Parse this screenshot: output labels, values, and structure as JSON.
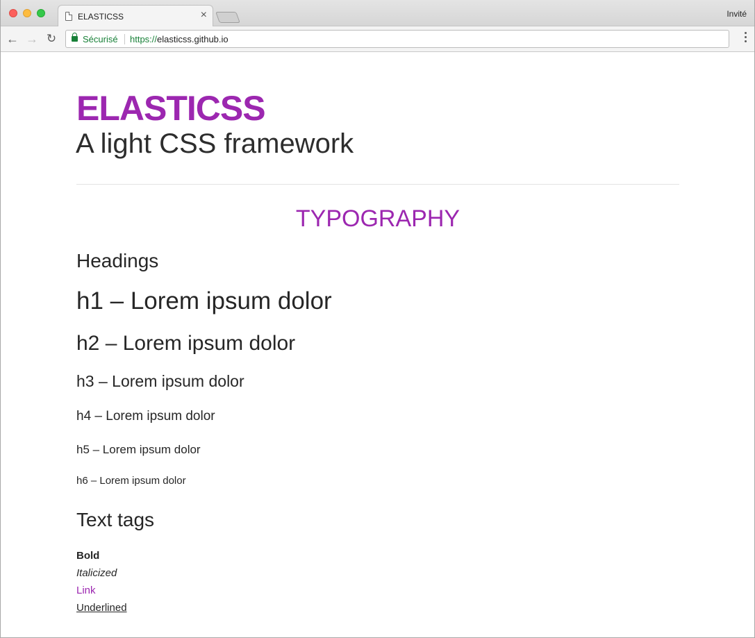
{
  "browser": {
    "tab_title": "ELASTICSS",
    "profile_label": "Invité",
    "secure_label": "Sécurisé",
    "url_scheme": "https://",
    "url_host": "elasticss.github.io"
  },
  "icons": {
    "tab": "page-icon",
    "tab_close": "close-icon",
    "back": "back-arrow-icon",
    "forward": "forward-arrow-icon",
    "reload": "reload-icon",
    "lock": "lock-icon",
    "menu": "kebab-menu-icon"
  },
  "colors": {
    "accent": "#9c27b0",
    "secure_green": "#188038",
    "text": "#262626"
  },
  "page": {
    "brand_title": "ELASTICSS",
    "brand_subtitle": "A light CSS framework",
    "section_title": "TYPOGRAPHY",
    "headings_title": "Headings",
    "headings": [
      "h1 – Lorem ipsum dolor",
      "h2 – Lorem ipsum dolor",
      "h3 – Lorem ipsum dolor",
      "h4 – Lorem ipsum dolor",
      "h5 – Lorem ipsum dolor",
      "h6 – Lorem ipsum dolor"
    ],
    "text_tags_title": "Text tags",
    "text_tags": {
      "bold": "Bold",
      "italic": "Italicized",
      "link": "Link",
      "underlined": "Underlined"
    }
  }
}
